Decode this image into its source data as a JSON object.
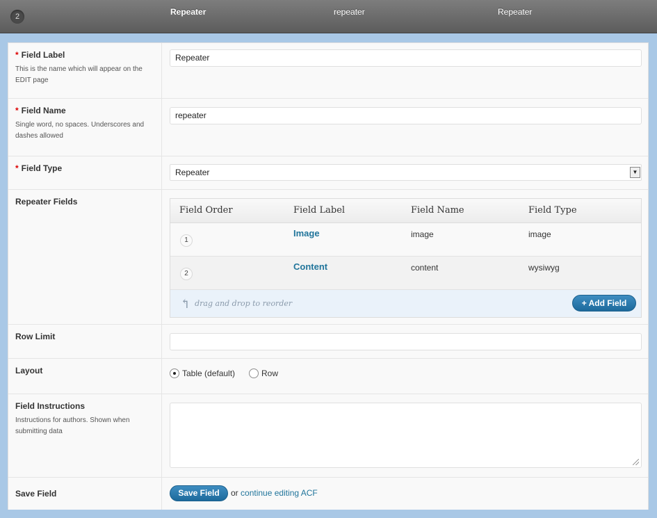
{
  "header": {
    "field_order": "2",
    "field_label": "Repeater",
    "field_name": "repeater",
    "field_type": "Repeater"
  },
  "form": {
    "field_label": {
      "label": "Field Label",
      "required_mark": "*",
      "description": "This is the name which will appear on the EDIT page",
      "value": "Repeater"
    },
    "field_name": {
      "label": "Field Name",
      "required_mark": "*",
      "description": "Single word, no spaces. Underscores and dashes allowed",
      "value": "repeater"
    },
    "field_type": {
      "label": "Field Type",
      "required_mark": "*",
      "selected": "Repeater",
      "arrow_icon": "dropdown-arrow-icon"
    },
    "repeater_fields": {
      "label": "Repeater Fields",
      "columns": [
        "Field Order",
        "Field Label",
        "Field Name",
        "Field Type"
      ],
      "rows": [
        {
          "order": "1",
          "label": "Image",
          "name": "image",
          "type": "image"
        },
        {
          "order": "2",
          "label": "Content",
          "name": "content",
          "type": "wysiwyg"
        }
      ],
      "drag_hint": "drag and drop to reorder",
      "add_button": "+ Add Field"
    },
    "row_limit": {
      "label": "Row Limit",
      "value": ""
    },
    "layout": {
      "label": "Layout",
      "options": [
        {
          "label": "Table (default)",
          "selected": true
        },
        {
          "label": "Row",
          "selected": false
        }
      ]
    },
    "field_instructions": {
      "label": "Field Instructions",
      "description": "Instructions for authors. Shown when submitting data",
      "value": ""
    },
    "save_field": {
      "label": "Save Field",
      "button": "Save Field",
      "or_text": "or",
      "link": "continue editing ACF"
    }
  },
  "colors": {
    "accent": "#21759b",
    "required": "#dd0000",
    "header_bg": "#6b6b6b",
    "frame_bg": "#a9c8e6"
  }
}
